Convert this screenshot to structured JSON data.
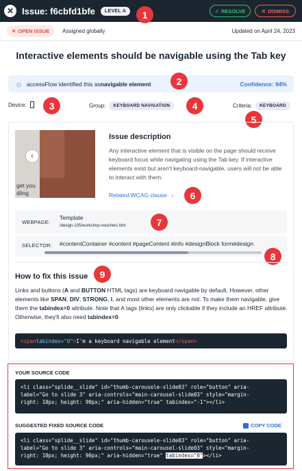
{
  "header": {
    "close_glyph": "✕",
    "issue_id": "Issue: f6cbfd1bfe",
    "level": "LEVEL A",
    "resolve_label": "RESOLVE",
    "dismiss_label": "DISMISS",
    "resolve_glyph": "✓",
    "dismiss_glyph": "✕"
  },
  "status": {
    "open_label": "OPEN ISSUE",
    "open_glyph": "✕",
    "assigned": "Assigned globally",
    "updated": "Updated on April 24, 2023"
  },
  "title": "Interactive elements should be navigable using the Tab key",
  "identified": {
    "prefix": "accessFlow identified this as ",
    "emphasis": "navigable element",
    "confidence": "Confidence: 94%"
  },
  "meta": {
    "device_label": "Device:",
    "group_label": "Group:",
    "group_value": "KEYBOARD NAVIGATION",
    "criteria_label": "Criteria:",
    "criteria_value": "KEYBOARD"
  },
  "description": {
    "title": "Issue description",
    "text": "Any interactive element that is visible on the page should receive keyboard focus while navigating using the Tab key. If interactive elements exist but aren't keyboard-navigable, users will not be able to interact with them.",
    "link": "Related WCAG clause",
    "link_glyph": "›",
    "thumb_text_1": "get you",
    "thumb_text_2": "dling",
    "thumb_arrow": "‹"
  },
  "webpage": {
    "label": "WEBPAGE:",
    "value": "Template",
    "path": "/design-105/workshop-vouchers.htm"
  },
  "selector": {
    "label": "SELECTOR:",
    "value": "#contentContainer #content #pageContent #info #designBlock form#design"
  },
  "how_to_fix": {
    "title": "How to fix this issue",
    "p1": "Links and buttons (",
    "b1": "A",
    "p2": " and ",
    "b2": "BUTTON",
    "p3": " HTML tags) are keyboard navigable by default. However, other elements like ",
    "b3": "SPAN",
    "p4": ", ",
    "b4": "DIV",
    "p5": ", ",
    "b5": "STRONG",
    "p6": ", ",
    "b6": "I",
    "p7": ", and most other elements are not. To make them navigable, give them the ",
    "b7": "tabindex=0",
    "p8": " attribute. Note that A tags (links) are only clickable if they include an HREF attribute. Otherwise, they'll also need ",
    "b8": "tabindex=0",
    "p9": "."
  },
  "example_code": {
    "open_tag": "<span",
    "attr": " tabindex=",
    "value": "\"0\"",
    "close_open": ">",
    "text": "I'm a keyboard navigable element",
    "close_tag": "</span>"
  },
  "source_code": {
    "title": "YOUR SOURCE CODE",
    "line1": "<li class=\"splide__slide\" id=\"thumb-carousele-slide03\" role=\"button\" aria-",
    "line2": "label=\"Go to slide 3\" aria-controls=\"main-carousel-slide03\" style=\"margin-",
    "line3": "right: 10px; height: 90px;\" aria-hidden=\"true\" tabindex=\"-1\"></li>"
  },
  "fixed_code": {
    "title": "SUGGESTED FIXED SOURCE CODE",
    "copy_label": "COPY CODE",
    "line1": "<li class=\"splide__slide\" id=\"thumb-carousele-slide03\" role=\"button\" aria-",
    "line2": "label=\"Go to slide 3\" aria-controls=\"main-carousel-slide03\" style=\"margin-",
    "line3a": "right: 10px; height: 90px;\" aria-hidden=\"true\" ",
    "line3hl": "tabindex=\"0\"",
    "line3b": "></li>"
  },
  "annotations": [
    "1",
    "2",
    "3",
    "4",
    "5",
    "6",
    "7",
    "8",
    "9"
  ],
  "colors": {
    "header_bg": "#1c2630",
    "accent_red": "#e8363a",
    "resolve_green": "#2fbf71",
    "link_blue": "#2f6fe0"
  }
}
